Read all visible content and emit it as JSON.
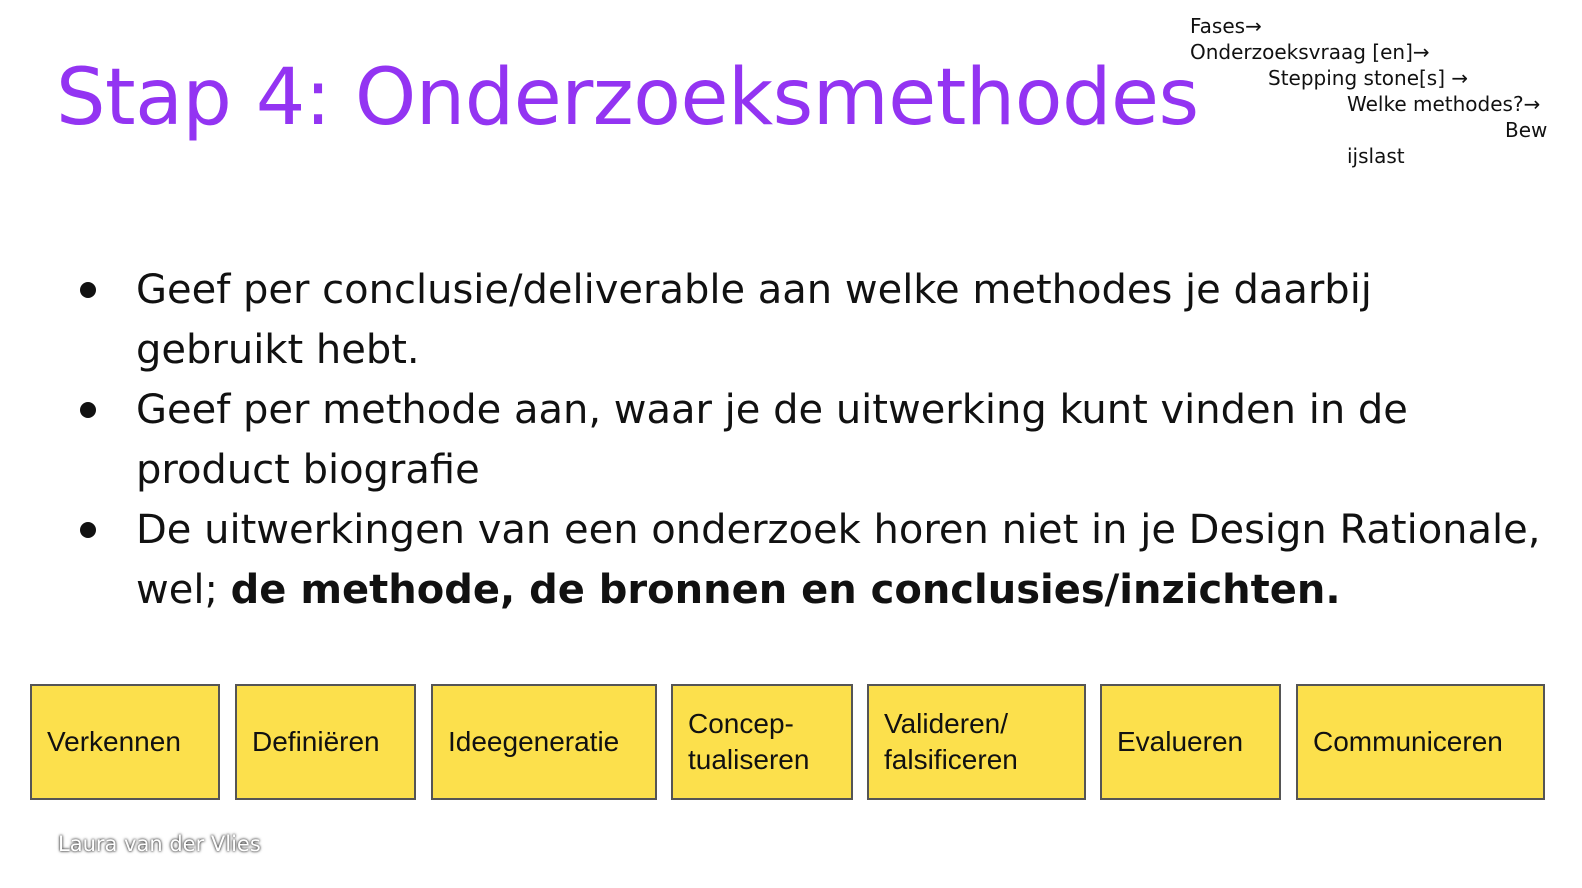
{
  "slide": {
    "title": "Stap 4: Onderzoeksmethodes",
    "author": "Laura van der Vlies"
  },
  "nav": {
    "line1": "Fases→",
    "line2": "Onderzoeksvraag [en]→",
    "line3": "Stepping stone[s] →",
    "line4": "Welke methodes?→",
    "line5": "Bew",
    "line6": "ijslast"
  },
  "bullets": [
    {
      "text": "Geef per conclusie/deliverable aan welke methodes je daarbij gebruikt hebt."
    },
    {
      "text": "Geef per methode aan, waar je de uitwerking kunt vinden in de product biografie"
    },
    {
      "text": "De uitwerkingen van een onderzoek horen niet in je Design Rationale, wel; ",
      "bold": "de methode, de bronnen en conclusies/inzichten."
    }
  ],
  "phases": [
    {
      "label": "Verkennen"
    },
    {
      "label": "Definiëren"
    },
    {
      "label": "Ideegeneratie"
    },
    {
      "label": "Concep-\ntualiseren"
    },
    {
      "label": "Valideren/\nfalsificeren"
    },
    {
      "label": "Evalueren"
    },
    {
      "label": "Communiceren"
    }
  ],
  "colors": {
    "title": "#9334f2",
    "phase_fill": "#fce04c",
    "phase_border": "#555555"
  }
}
